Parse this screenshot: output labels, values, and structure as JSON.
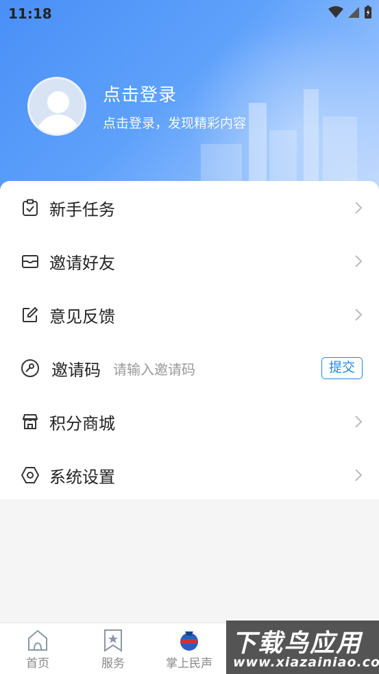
{
  "status_bar": {
    "time": "11:18"
  },
  "profile": {
    "login_title": "点击登录",
    "login_subtitle": "点击登录，发现精彩内容"
  },
  "menu": {
    "items": [
      {
        "label": "新手任务",
        "icon": "task-check-icon"
      },
      {
        "label": "邀请好友",
        "icon": "invite-envelope-icon"
      },
      {
        "label": "意见反馈",
        "icon": "edit-feedback-icon"
      },
      {
        "label": "积分商城",
        "icon": "store-icon"
      },
      {
        "label": "系统设置",
        "icon": "settings-hexagon-icon"
      }
    ],
    "invite_code": {
      "label": "邀请码",
      "placeholder": "请输入邀请码",
      "submit_label": "提交",
      "icon": "key-icon"
    }
  },
  "tabbar": {
    "items": [
      {
        "label": "首页",
        "icon": "home-icon"
      },
      {
        "label": "服务",
        "icon": "bookmark-star-icon"
      },
      {
        "label": "掌上民声",
        "icon": "minsheng-logo-icon"
      }
    ]
  },
  "watermark": {
    "line1": "下载鸟应用",
    "line2": "www.xiazainiao.com"
  },
  "colors": {
    "accent": "#1e88e5",
    "hero_start": "#4a8ff7",
    "hero_end": "#c6dcfd"
  }
}
